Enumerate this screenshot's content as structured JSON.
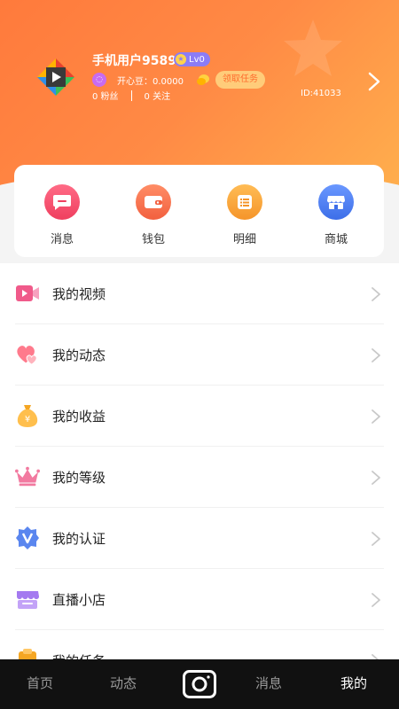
{
  "profile": {
    "username": "手机用户9589",
    "level": "Lv0",
    "bean_label": "开心豆：0.0000",
    "task_button": "领取任务",
    "fans": "0 粉丝",
    "follows": "0 关注",
    "user_id": "ID:41033"
  },
  "quick_actions": [
    {
      "label": "消息",
      "color": "#f2546f"
    },
    {
      "label": "钱包",
      "color": "#f57a55"
    },
    {
      "label": "明细",
      "color": "#f8a23a"
    },
    {
      "label": "商城",
      "color": "#4f7ff0"
    }
  ],
  "menu": [
    {
      "label": "我的视频"
    },
    {
      "label": "我的动态"
    },
    {
      "label": "我的收益"
    },
    {
      "label": "我的等级"
    },
    {
      "label": "我的认证"
    },
    {
      "label": "直播小店"
    },
    {
      "label": "我的任务"
    }
  ],
  "tabs": {
    "home": "首页",
    "feed": "动态",
    "messages": "消息",
    "mine": "我的"
  }
}
